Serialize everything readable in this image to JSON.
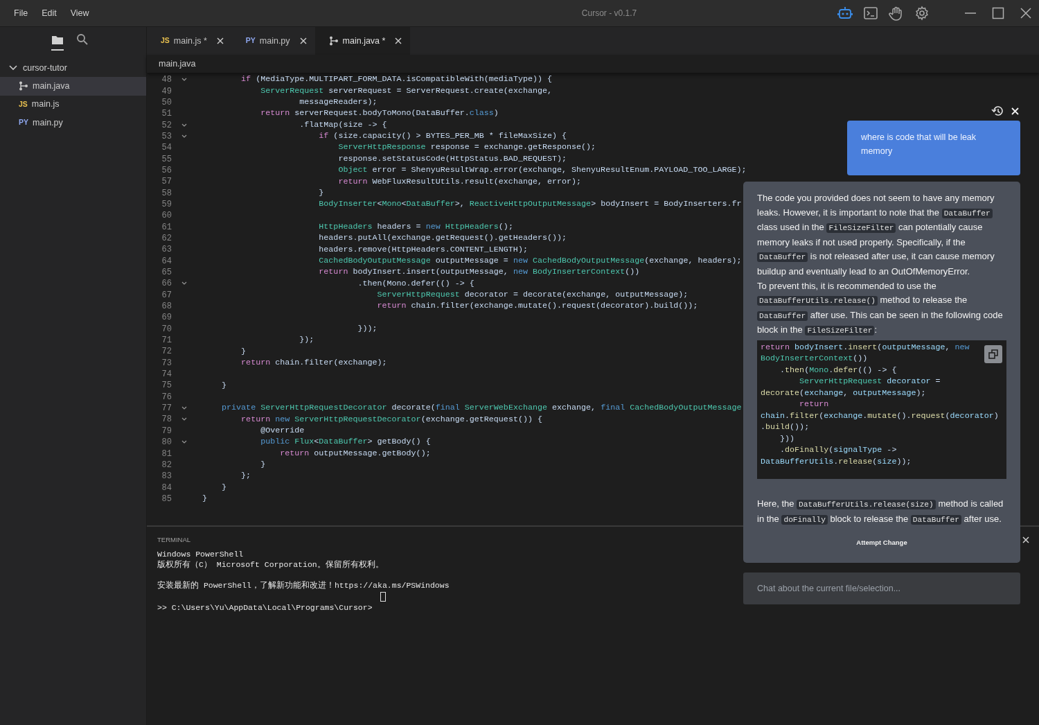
{
  "window": {
    "title": "Cursor - v0.1.7",
    "menu": [
      "File",
      "Edit",
      "View"
    ],
    "toolbar": [
      {
        "kind": "robot",
        "selected": true
      },
      {
        "kind": "terminal",
        "selected": false
      },
      {
        "kind": "hand",
        "selected": false
      },
      {
        "kind": "gear",
        "selected": false
      }
    ]
  },
  "sidebar": {
    "views": [
      {
        "kind": "folder",
        "selected": true
      },
      {
        "kind": "search",
        "selected": false
      }
    ],
    "tree": {
      "label": "cursor-tutor",
      "expanded": true,
      "children": [
        {
          "label": "main.java",
          "kind": "java",
          "selected": true
        },
        {
          "label": "main.js",
          "kind": "js",
          "badge": "JS",
          "selected": false
        },
        {
          "label": "main.py",
          "kind": "py",
          "badge": "PY",
          "selected": false
        }
      ]
    }
  },
  "tabs": [
    {
      "label": "main.js *",
      "kind": "js",
      "badge": "JS",
      "selected": false
    },
    {
      "label": "main.py",
      "kind": "py",
      "badge": "PY",
      "selected": false
    },
    {
      "label": "main.java *",
      "kind": "java",
      "selected": true
    }
  ],
  "breadcrumb": "main.java",
  "editor": {
    "lines": [
      {
        "number": "48",
        "foldable": true,
        "tokens": [
          {
            "text": "        if",
            "kind": "kw"
          },
          {
            "text": " (MediaType.MULTIPART_FORM_DATA.isCompatibleWith(mediaType)) {",
            "kind": "plain"
          }
        ]
      },
      {
        "number": "49",
        "foldable": false,
        "tokens": [
          {
            "text": "            ServerRequest",
            "kind": "type"
          },
          {
            "text": " serverRequest = ServerRequest.create(exchange,",
            "kind": "plain"
          }
        ]
      },
      {
        "number": "50",
        "foldable": false,
        "tokens": [
          {
            "text": "                    messageReaders);",
            "kind": "plain"
          }
        ]
      },
      {
        "number": "51",
        "foldable": false,
        "tokens": [
          {
            "text": "            return",
            "kind": "kw"
          },
          {
            "text": " serverRequest.bodyToMono(DataBuffer.",
            "kind": "plain"
          },
          {
            "text": "class",
            "kind": "storage"
          },
          {
            "text": ")",
            "kind": "plain"
          }
        ]
      },
      {
        "number": "52",
        "foldable": true,
        "tokens": [
          {
            "text": "                    .flatMap(size -> {",
            "kind": "plain"
          }
        ]
      },
      {
        "number": "53",
        "foldable": true,
        "tokens": [
          {
            "text": "                        if",
            "kind": "kw"
          },
          {
            "text": " (size.capacity() > BYTES_PER_MB * fileMaxSize) {",
            "kind": "plain"
          }
        ]
      },
      {
        "number": "54",
        "foldable": false,
        "tokens": [
          {
            "text": "                            ServerHttpResponse",
            "kind": "type"
          },
          {
            "text": " response = exchange.getResponse();",
            "kind": "plain"
          }
        ]
      },
      {
        "number": "55",
        "foldable": false,
        "tokens": [
          {
            "text": "                            response.setStatusCode(HttpStatus.BAD_REQUEST);",
            "kind": "plain"
          }
        ]
      },
      {
        "number": "56",
        "foldable": false,
        "tokens": [
          {
            "text": "                            Object",
            "kind": "type"
          },
          {
            "text": " error = ShenyuResultWrap.error(exchange, ShenyuResultEnum.PAYLOAD_TOO_LARGE);",
            "kind": "plain"
          }
        ]
      },
      {
        "number": "57",
        "foldable": false,
        "tokens": [
          {
            "text": "                            return",
            "kind": "kw"
          },
          {
            "text": " WebFluxResultUtils.result(exchange, error);",
            "kind": "plain"
          }
        ]
      },
      {
        "number": "58",
        "foldable": false,
        "tokens": [
          {
            "text": "                        }",
            "kind": "plain"
          }
        ]
      },
      {
        "number": "59",
        "foldable": false,
        "tokens": [
          {
            "text": "                        BodyInserter",
            "kind": "type"
          },
          {
            "text": "<",
            "kind": "plain"
          },
          {
            "text": "Mono",
            "kind": "type"
          },
          {
            "text": "<",
            "kind": "plain"
          },
          {
            "text": "DataBuffer",
            "kind": "type"
          },
          {
            "text": ">, ",
            "kind": "plain"
          },
          {
            "text": "ReactiveHttpOutputMessage",
            "kind": "type"
          },
          {
            "text": "> bodyInsert = BodyInserters.fr",
            "kind": "plain"
          }
        ]
      },
      {
        "number": "60",
        "foldable": false
      },
      {
        "number": "61",
        "foldable": false,
        "tokens": [
          {
            "text": "                        HttpHeaders",
            "kind": "type"
          },
          {
            "text": " headers = ",
            "kind": "plain"
          },
          {
            "text": "new ",
            "kind": "storage"
          },
          {
            "text": "HttpHeaders",
            "kind": "type"
          },
          {
            "text": "();",
            "kind": "plain"
          }
        ]
      },
      {
        "number": "62",
        "foldable": false,
        "tokens": [
          {
            "text": "                        headers.putAll(exchange.getRequest().getHeaders());",
            "kind": "plain"
          }
        ]
      },
      {
        "number": "63",
        "foldable": false,
        "tokens": [
          {
            "text": "                        headers.remove(HttpHeaders.CONTENT_LENGTH);",
            "kind": "plain"
          }
        ]
      },
      {
        "number": "64",
        "foldable": false,
        "tokens": [
          {
            "text": "                        CachedBodyOutputMessage",
            "kind": "type"
          },
          {
            "text": " outputMessage = ",
            "kind": "plain"
          },
          {
            "text": "new ",
            "kind": "storage"
          },
          {
            "text": "CachedBodyOutputMessage",
            "kind": "type"
          },
          {
            "text": "(exchange, headers);",
            "kind": "plain"
          }
        ]
      },
      {
        "number": "65",
        "foldable": false,
        "tokens": [
          {
            "text": "                        return",
            "kind": "kw"
          },
          {
            "text": " bodyInsert.insert(outputMessage, ",
            "kind": "plain"
          },
          {
            "text": "new ",
            "kind": "storage"
          },
          {
            "text": "BodyInserterContext",
            "kind": "type"
          },
          {
            "text": "())",
            "kind": "plain"
          }
        ]
      },
      {
        "number": "66",
        "foldable": true,
        "tokens": [
          {
            "text": "                                .then(Mono.defer(() -> {",
            "kind": "plain"
          }
        ]
      },
      {
        "number": "67",
        "foldable": false,
        "tokens": [
          {
            "text": "                                    ServerHttpRequest",
            "kind": "type"
          },
          {
            "text": " decorator = decorate(exchange, outputMessage);",
            "kind": "plain"
          }
        ]
      },
      {
        "number": "68",
        "foldable": false,
        "tokens": [
          {
            "text": "                                    return",
            "kind": "kw"
          },
          {
            "text": " chain.filter(exchange.mutate().request(decorator).build());",
            "kind": "plain"
          }
        ]
      },
      {
        "number": "69",
        "foldable": false
      },
      {
        "number": "70",
        "foldable": false,
        "tokens": [
          {
            "text": "                                }));",
            "kind": "plain"
          }
        ]
      },
      {
        "number": "71",
        "foldable": false,
        "tokens": [
          {
            "text": "                    });",
            "kind": "plain"
          }
        ]
      },
      {
        "number": "72",
        "foldable": false,
        "tokens": [
          {
            "text": "        }",
            "kind": "plain"
          }
        ]
      },
      {
        "number": "73",
        "foldable": false,
        "tokens": [
          {
            "text": "        return",
            "kind": "kw"
          },
          {
            "text": " chain.filter(exchange);",
            "kind": "plain"
          }
        ]
      },
      {
        "number": "74",
        "foldable": false
      },
      {
        "number": "75",
        "foldable": false,
        "tokens": [
          {
            "text": "    }",
            "kind": "plain"
          }
        ]
      },
      {
        "number": "76",
        "foldable": false
      },
      {
        "number": "77",
        "foldable": true,
        "tokens": [
          {
            "text": "    private ",
            "kind": "storage"
          },
          {
            "text": "ServerHttpRequestDecorator",
            "kind": "type"
          },
          {
            "text": " decorate(",
            "kind": "plain"
          },
          {
            "text": "final ",
            "kind": "storage"
          },
          {
            "text": "ServerWebExchange",
            "kind": "type"
          },
          {
            "text": " exchange, ",
            "kind": "plain"
          },
          {
            "text": "final ",
            "kind": "storage"
          },
          {
            "text": "CachedBodyOutputMessage",
            "kind": "type"
          }
        ]
      },
      {
        "number": "78",
        "foldable": true,
        "tokens": [
          {
            "text": "        return",
            "kind": "kw"
          },
          {
            "text": " new ",
            "kind": "storage"
          },
          {
            "text": "ServerHttpRequestDecorator",
            "kind": "type"
          },
          {
            "text": "(exchange.getRequest()) {",
            "kind": "plain"
          }
        ]
      },
      {
        "number": "79",
        "foldable": false,
        "tokens": [
          {
            "text": "            @Override",
            "kind": "plain"
          }
        ]
      },
      {
        "number": "80",
        "foldable": true,
        "tokens": [
          {
            "text": "            public ",
            "kind": "storage"
          },
          {
            "text": "Flux",
            "kind": "type"
          },
          {
            "text": "<",
            "kind": "plain"
          },
          {
            "text": "DataBuffer",
            "kind": "type"
          },
          {
            "text": "> getBody() {",
            "kind": "plain"
          }
        ]
      },
      {
        "number": "81",
        "foldable": false,
        "tokens": [
          {
            "text": "                return",
            "kind": "kw"
          },
          {
            "text": " outputMessage.getBody();",
            "kind": "plain"
          }
        ]
      },
      {
        "number": "82",
        "foldable": false,
        "tokens": [
          {
            "text": "            }",
            "kind": "plain"
          }
        ]
      },
      {
        "number": "83",
        "foldable": false,
        "tokens": [
          {
            "text": "        };",
            "kind": "plain"
          }
        ]
      },
      {
        "number": "84",
        "foldable": false,
        "tokens": [
          {
            "text": "    }",
            "kind": "plain"
          }
        ]
      },
      {
        "number": "85",
        "foldable": false,
        "tokens": [
          {
            "text": "}",
            "kind": "plain"
          }
        ]
      }
    ]
  },
  "terminal": {
    "title": "TERMINAL",
    "lines": [
      {
        "kind": "output",
        "text": "Windows PowerShell"
      },
      {
        "kind": "output",
        "text": "版权所有（C） Microsoft Corporation。保留所有权利。"
      },
      {
        "kind": "notice",
        "text": "安装最新的 PowerShell，了解新功能和改进！https://aka.ms/PSWindows"
      },
      {
        "kind": "prompt",
        "text": ">> C:\\Users\\Yu\\AppData\\Local\\Programs\\Cursor>"
      }
    ]
  },
  "chat": {
    "question": "where is code that will be leak memory",
    "answer": [
      {
        "kind": "text",
        "parts": [
          {
            "text": "The code you provided does not seem to have any memory leaks. However, it is important to note that the ",
            "kind": "plain"
          },
          {
            "text": "DataBuffer",
            "kind": "code"
          },
          {
            "text": " class used in the ",
            "kind": "plain"
          },
          {
            "text": "FileSizeFilter",
            "kind": "code"
          },
          {
            "text": " can potentially cause memory leaks if not used properly. Specifically, if the ",
            "kind": "plain"
          },
          {
            "text": "DataBuffer",
            "kind": "code"
          },
          {
            "text": " is not released after use, it can cause memory buildup and eventually lead to an OutOfMemoryError.",
            "kind": "plain"
          }
        ]
      },
      {
        "kind": "text",
        "parts": [
          {
            "text": "To prevent this, it is recommended to use the ",
            "kind": "plain"
          },
          {
            "text": "DataBufferUtils.release()",
            "kind": "code"
          },
          {
            "text": " method to release the ",
            "kind": "plain"
          },
          {
            "text": "DataBuffer",
            "kind": "code"
          },
          {
            "text": " after use. This can be seen in the following code block in the ",
            "kind": "plain"
          },
          {
            "text": "FileSizeFilter",
            "kind": "code"
          },
          {
            "text": ":",
            "kind": "plain"
          }
        ]
      },
      {
        "kind": "code",
        "lines": [
          [
            {
              "text": "return ",
              "kind": "kw"
            },
            {
              "text": "bodyInsert",
              "kind": "var"
            },
            {
              "text": ".",
              "kind": "plain"
            },
            {
              "text": "insert",
              "kind": "fn"
            },
            {
              "text": "(",
              "kind": "plain"
            },
            {
              "text": "outputMessage",
              "kind": "var"
            },
            {
              "text": ", ",
              "kind": "plain"
            },
            {
              "text": "new",
              "kind": "storage"
            }
          ],
          [
            {
              "text": "BodyInserterContext",
              "kind": "type"
            },
            {
              "text": "())",
              "kind": "plain"
            }
          ],
          [
            {
              "text": "    .",
              "kind": "plain"
            },
            {
              "text": "then",
              "kind": "fn"
            },
            {
              "text": "(",
              "kind": "plain"
            },
            {
              "text": "Mono",
              "kind": "type"
            },
            {
              "text": ".",
              "kind": "plain"
            },
            {
              "text": "defer",
              "kind": "fn"
            },
            {
              "text": "(() -> {",
              "kind": "plain"
            }
          ],
          [
            {
              "text": "        ServerHttpRequest",
              "kind": "type"
            },
            {
              "text": " decorator",
              "kind": "var"
            },
            {
              "text": " =",
              "kind": "plain"
            }
          ],
          [
            {
              "text": "decorate",
              "kind": "fn"
            },
            {
              "text": "(",
              "kind": "plain"
            },
            {
              "text": "exchange",
              "kind": "var"
            },
            {
              "text": ", ",
              "kind": "plain"
            },
            {
              "text": "outputMessage",
              "kind": "var"
            },
            {
              "text": ");",
              "kind": "plain"
            }
          ],
          [
            {
              "text": "        return",
              "kind": "kw"
            }
          ],
          [
            {
              "text": "chain",
              "kind": "var"
            },
            {
              "text": ".",
              "kind": "plain"
            },
            {
              "text": "filter",
              "kind": "fn"
            },
            {
              "text": "(",
              "kind": "plain"
            },
            {
              "text": "exchange",
              "kind": "var"
            },
            {
              "text": ".",
              "kind": "plain"
            },
            {
              "text": "mutate",
              "kind": "fn"
            },
            {
              "text": "().",
              "kind": "plain"
            },
            {
              "text": "request",
              "kind": "fn"
            },
            {
              "text": "(",
              "kind": "plain"
            },
            {
              "text": "decorator",
              "kind": "var"
            },
            {
              "text": ")",
              "kind": "plain"
            }
          ],
          [
            {
              "text": ".",
              "kind": "plain"
            },
            {
              "text": "build",
              "kind": "fn"
            },
            {
              "text": "());",
              "kind": "plain"
            }
          ],
          [
            {
              "text": "    }))",
              "kind": "plain"
            }
          ],
          [
            {
              "text": "    .",
              "kind": "plain"
            },
            {
              "text": "doFinally",
              "kind": "fn"
            },
            {
              "text": "(",
              "kind": "plain"
            },
            {
              "text": "signalType",
              "kind": "var"
            },
            {
              "text": " ->",
              "kind": "plain"
            }
          ],
          [
            {
              "text": "DataBufferUtils",
              "kind": "var"
            },
            {
              "text": ".",
              "kind": "plain"
            },
            {
              "text": "release",
              "kind": "fn"
            },
            {
              "text": "(",
              "kind": "plain"
            },
            {
              "text": "size",
              "kind": "var"
            },
            {
              "text": "));",
              "kind": "plain"
            }
          ]
        ]
      },
      {
        "kind": "text",
        "parts": [
          {
            "text": "Here, the ",
            "kind": "plain"
          },
          {
            "text": "DataBufferUtils.release(size)",
            "kind": "code"
          },
          {
            "text": " method is called in the ",
            "kind": "plain"
          },
          {
            "text": "doFinally",
            "kind": "code"
          },
          {
            "text": " block to release the ",
            "kind": "plain"
          },
          {
            "text": "DataBuffer",
            "kind": "code"
          },
          {
            "text": " after use.",
            "kind": "plain"
          }
        ]
      }
    ],
    "action": "Attempt Change",
    "input": {
      "placeholder": "Chat about the current file/selection..."
    }
  }
}
